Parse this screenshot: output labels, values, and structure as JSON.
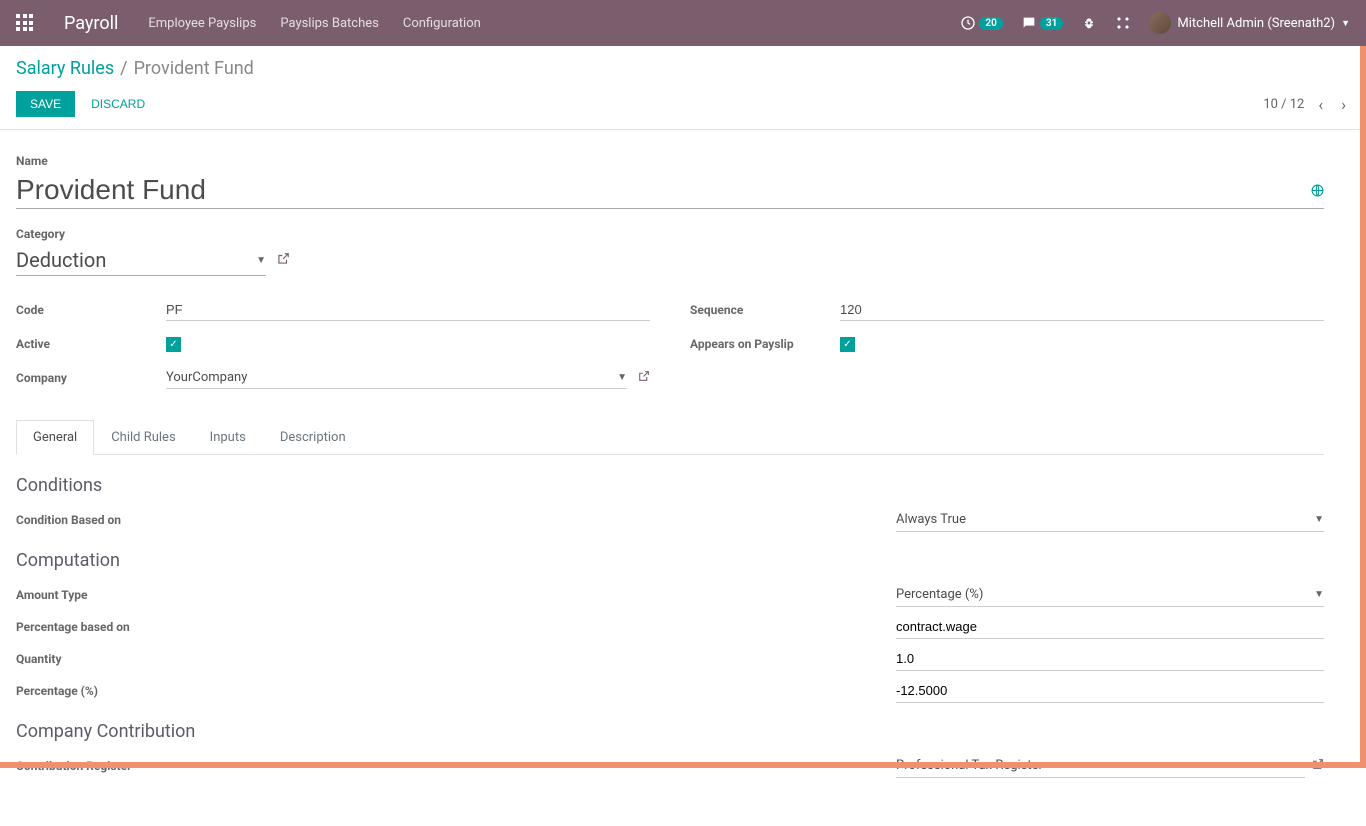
{
  "navbar": {
    "brand": "Payroll",
    "links": [
      "Employee Payslips",
      "Payslips Batches",
      "Configuration"
    ],
    "activity_count": "20",
    "message_count": "31",
    "user_name": "Mitchell Admin (Sreenath2)"
  },
  "breadcrumb": {
    "parent": "Salary Rules",
    "current": "Provident Fund"
  },
  "actions": {
    "save": "Save",
    "discard": "Discard"
  },
  "pager": {
    "text": "10 / 12"
  },
  "form": {
    "name_label": "Name",
    "name_value": "Provident Fund",
    "category_label": "Category",
    "category_value": "Deduction",
    "code_label": "Code",
    "code_value": "PF",
    "active_label": "Active",
    "company_label": "Company",
    "company_value": "YourCompany",
    "sequence_label": "Sequence",
    "sequence_value": "120",
    "appears_label": "Appears on Payslip"
  },
  "tabs": {
    "general": "General",
    "child_rules": "Child Rules",
    "inputs": "Inputs",
    "description": "Description"
  },
  "general_tab": {
    "conditions_title": "Conditions",
    "condition_based_label": "Condition Based on",
    "condition_based_value": "Always True",
    "computation_title": "Computation",
    "amount_type_label": "Amount Type",
    "amount_type_value": "Percentage (%)",
    "pct_based_label": "Percentage based on",
    "pct_based_value": "contract.wage",
    "quantity_label": "Quantity",
    "quantity_value": "1.0",
    "percentage_label": "Percentage (%)",
    "percentage_value": "-12.5000",
    "company_contrib_title": "Company Contribution",
    "contrib_register_label": "Contribution Register",
    "contrib_register_value": "Professional Tax Register"
  }
}
